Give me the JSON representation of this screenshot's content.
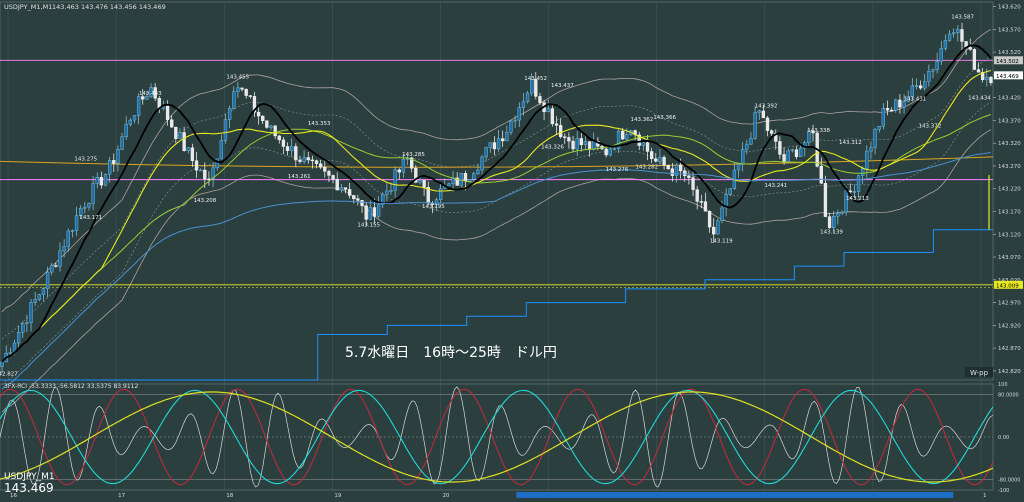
{
  "header": {
    "symbol_info": "USDJPY_M1,M1",
    "ohlc": "143.463 143.476 143.456 143.469"
  },
  "colors": {
    "background": "#2b3f3f",
    "grid": "#3f5757",
    "candle_up": "#87ceeb",
    "candle_down": "#ffffff",
    "ma_fast": "#000000",
    "ma_mid": "#e8e820",
    "ma_slow": "#9acd32",
    "boll": "#b0a0a0",
    "step_line": "#1e90ff",
    "h_pink": "#ff80ff",
    "h_gold": "#daa520",
    "h_yellow": "#e8e820",
    "osc_white": "#d8d8d8",
    "osc_cyan": "#20d8d8",
    "osc_red": "#c8283c",
    "osc_yellow": "#e0e020",
    "price_label_bg": "#e8e820"
  },
  "annotation": "5.7水曜日　16時～25時　ドル円",
  "wpp_label": "W-pp",
  "price_axis": [
    "143.620",
    "143.570",
    "143.520",
    "143.470",
    "143.420",
    "143.370",
    "143.320",
    "143.270",
    "143.220",
    "143.170",
    "143.120",
    "143.070",
    "143.020",
    "142.970",
    "142.920",
    "142.870",
    "142.820"
  ],
  "price_tags": {
    "current": "143.469",
    "pink_line": "143.502",
    "yellow_line": "143.009"
  },
  "time_axis": [
    "16",
    "17",
    "18",
    "19",
    "20",
    "21",
    "22",
    "23",
    "0",
    "1"
  ],
  "bottom": {
    "symbol": "USDJPY_M1",
    "price": "143.469"
  },
  "oscillator": {
    "title": "3FX-RCI -53.3333 -56.5812 33.5375 83.9112",
    "axis": [
      "100",
      "80.0000",
      "0.00",
      "-80.0000",
      "-100"
    ]
  },
  "chart_data": {
    "type": "candlestick",
    "title": "USDJPY_M1,M1 143.463 143.476 143.456 143.469",
    "ylim": [
      142.8,
      143.63
    ],
    "hlines": [
      143.502,
      143.009,
      143.24
    ],
    "x": [
      "16",
      "17",
      "18",
      "19",
      "20",
      "21",
      "22",
      "23",
      "0",
      "1"
    ],
    "price_points": [
      {
        "t": 0.0,
        "v": 142.84
      },
      {
        "t": 0.04,
        "v": 143.0
      },
      {
        "t": 0.08,
        "v": 143.18
      },
      {
        "t": 0.11,
        "v": 143.27
      },
      {
        "t": 0.13,
        "v": 143.38
      },
      {
        "t": 0.15,
        "v": 143.443
      },
      {
        "t": 0.19,
        "v": 143.29
      },
      {
        "t": 0.21,
        "v": 143.23
      },
      {
        "t": 0.235,
        "v": 143.455
      },
      {
        "t": 0.27,
        "v": 143.35
      },
      {
        "t": 0.31,
        "v": 143.27
      },
      {
        "t": 0.35,
        "v": 143.22
      },
      {
        "t": 0.37,
        "v": 143.155
      },
      {
        "t": 0.41,
        "v": 143.285
      },
      {
        "t": 0.43,
        "v": 143.195
      },
      {
        "t": 0.47,
        "v": 143.25
      },
      {
        "t": 0.51,
        "v": 143.35
      },
      {
        "t": 0.535,
        "v": 143.452
      },
      {
        "t": 0.57,
        "v": 143.33
      },
      {
        "t": 0.61,
        "v": 143.3
      },
      {
        "t": 0.635,
        "v": 143.362
      },
      {
        "t": 0.66,
        "v": 143.28
      },
      {
        "t": 0.69,
        "v": 143.25
      },
      {
        "t": 0.72,
        "v": 143.119
      },
      {
        "t": 0.765,
        "v": 143.392
      },
      {
        "t": 0.79,
        "v": 143.28
      },
      {
        "t": 0.82,
        "v": 143.338
      },
      {
        "t": 0.835,
        "v": 143.139
      },
      {
        "t": 0.86,
        "v": 143.22
      },
      {
        "t": 0.89,
        "v": 143.38
      },
      {
        "t": 0.92,
        "v": 143.431
      },
      {
        "t": 0.945,
        "v": 143.5
      },
      {
        "t": 0.96,
        "v": 143.587
      },
      {
        "t": 0.99,
        "v": 143.469
      }
    ],
    "price_labels": [
      {
        "t": 0.005,
        "v": 142.827,
        "text": "142.827"
      },
      {
        "t": 0.085,
        "v": 143.275,
        "text": "143.275"
      },
      {
        "t": 0.09,
        "v": 143.171,
        "text": "143.171"
      },
      {
        "t": 0.15,
        "v": 143.443,
        "text": "143.443"
      },
      {
        "t": 0.205,
        "v": 143.208,
        "text": "143.208"
      },
      {
        "t": 0.238,
        "v": 143.455,
        "text": "143.455"
      },
      {
        "t": 0.3,
        "v": 143.261,
        "text": "143.261"
      },
      {
        "t": 0.32,
        "v": 143.353,
        "text": "143.353"
      },
      {
        "t": 0.37,
        "v": 143.155,
        "text": "143.155"
      },
      {
        "t": 0.415,
        "v": 143.285,
        "text": "143.285"
      },
      {
        "t": 0.435,
        "v": 143.195,
        "text": "143.195"
      },
      {
        "t": 0.538,
        "v": 143.452,
        "text": "143.452"
      },
      {
        "t": 0.565,
        "v": 143.437,
        "text": "143.437"
      },
      {
        "t": 0.555,
        "v": 143.326,
        "text": "143.326"
      },
      {
        "t": 0.62,
        "v": 143.276,
        "text": "143.276"
      },
      {
        "t": 0.645,
        "v": 143.362,
        "text": "143.362"
      },
      {
        "t": 0.65,
        "v": 143.282,
        "text": "143.282"
      },
      {
        "t": 0.668,
        "v": 143.366,
        "text": "143.366"
      },
      {
        "t": 0.725,
        "v": 143.119,
        "text": "143.119"
      },
      {
        "t": 0.77,
        "v": 143.392,
        "text": "143.392"
      },
      {
        "t": 0.78,
        "v": 143.241,
        "text": "143.241"
      },
      {
        "t": 0.823,
        "v": 143.338,
        "text": "143.338"
      },
      {
        "t": 0.836,
        "v": 143.139,
        "text": "143.139"
      },
      {
        "t": 0.855,
        "v": 143.312,
        "text": "143.312"
      },
      {
        "t": 0.862,
        "v": 143.213,
        "text": "143.213"
      },
      {
        "t": 0.92,
        "v": 143.431,
        "text": "143.431"
      },
      {
        "t": 0.935,
        "v": 143.372,
        "text": "143.372"
      },
      {
        "t": 0.968,
        "v": 143.587,
        "text": "143.587"
      },
      {
        "t": 0.985,
        "v": 143.434,
        "text": "143.434"
      }
    ],
    "step_points": [
      {
        "t": 0.0,
        "v": 142.8
      },
      {
        "t": 0.32,
        "v": 142.9
      },
      {
        "t": 0.39,
        "v": 142.92
      },
      {
        "t": 0.47,
        "v": 142.94
      },
      {
        "t": 0.53,
        "v": 142.97
      },
      {
        "t": 0.63,
        "v": 143.0
      },
      {
        "t": 0.71,
        "v": 143.02
      },
      {
        "t": 0.8,
        "v": 143.05
      },
      {
        "t": 0.85,
        "v": 143.08
      },
      {
        "t": 0.94,
        "v": 143.13
      },
      {
        "t": 1.0,
        "v": 143.13
      }
    ],
    "oscillator_range": [
      -100,
      100
    ]
  }
}
